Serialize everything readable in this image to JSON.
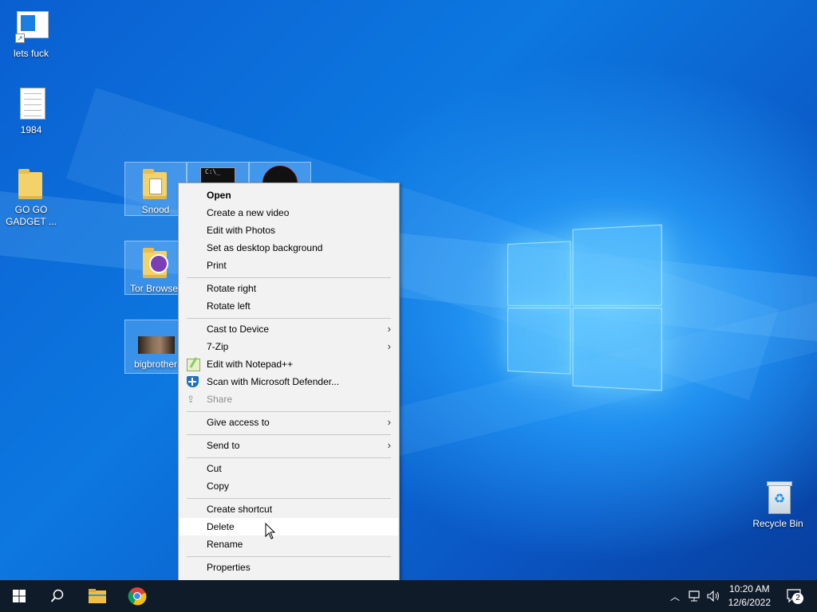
{
  "desktop": {
    "icons": [
      {
        "label": "lets fuck",
        "type": "shortcut"
      },
      {
        "label": "1984",
        "type": "document"
      },
      {
        "label": "GO GO\nGADGET ...",
        "type": "folder"
      },
      {
        "label": "Snood",
        "type": "folder"
      },
      {
        "label": "Tor Browser",
        "type": "folder"
      },
      {
        "label": "bigbrother",
        "type": "image"
      },
      {
        "label": "Recycle Bin",
        "type": "recycle-bin"
      }
    ]
  },
  "context_menu": {
    "items": [
      {
        "label": "Open",
        "bold": true
      },
      {
        "label": "Create a new video"
      },
      {
        "label": "Edit with Photos"
      },
      {
        "label": "Set as desktop background"
      },
      {
        "label": "Print"
      },
      {
        "label": "Rotate right"
      },
      {
        "label": "Rotate left"
      },
      {
        "label": "Cast to Device",
        "submenu": true
      },
      {
        "label": "7-Zip",
        "submenu": true
      },
      {
        "label": "Edit with Notepad++",
        "icon": "notepadpp-icon"
      },
      {
        "label": "Scan with Microsoft Defender...",
        "icon": "defender-icon"
      },
      {
        "label": "Share",
        "icon": "share-icon",
        "disabled": true
      },
      {
        "label": "Give access to",
        "submenu": true
      },
      {
        "label": "Send to",
        "submenu": true
      },
      {
        "label": "Cut"
      },
      {
        "label": "Copy"
      },
      {
        "label": "Create shortcut"
      },
      {
        "label": "Delete",
        "hovered": true
      },
      {
        "label": "Rename"
      },
      {
        "label": "Properties"
      }
    ],
    "submenu_arrow": "›"
  },
  "taskbar": {
    "clock_time": "10:20 AM",
    "clock_date": "12/6/2022",
    "notification_count": "2",
    "pinned": [
      "start-button",
      "search-button",
      "file-explorer",
      "chrome"
    ]
  }
}
